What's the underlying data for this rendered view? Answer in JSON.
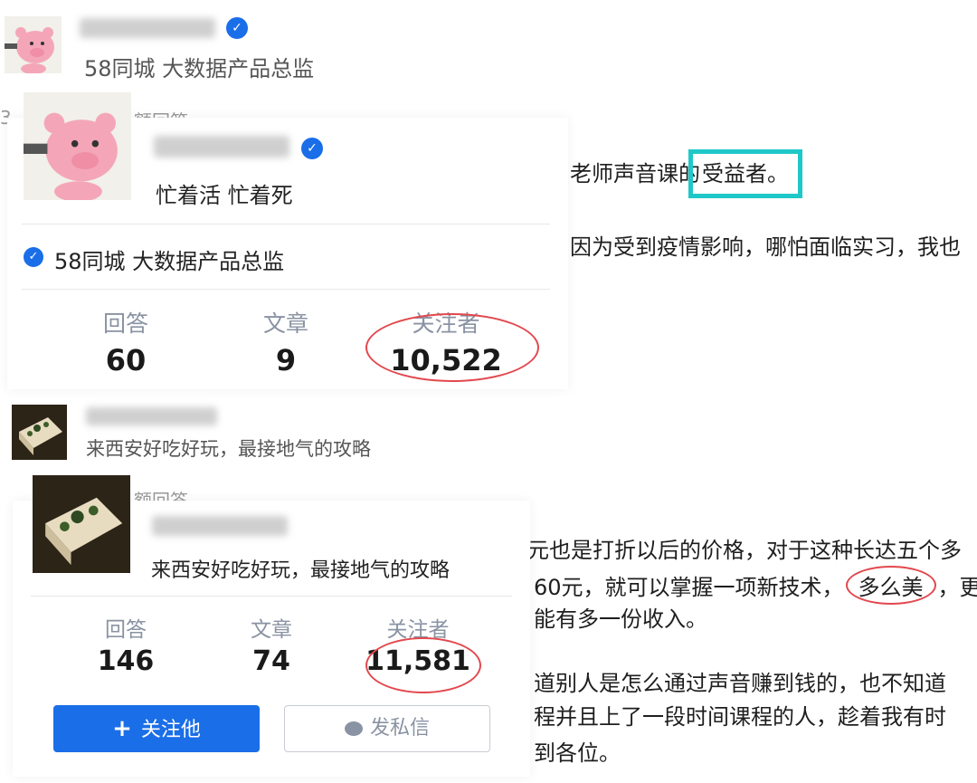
{
  "profile1": {
    "header_subtitle": "58同城 大数据产品总监",
    "partial_text_under": "3",
    "partial_text_tag": "额回答",
    "card": {
      "bio": "忙着活 忙着死",
      "company": "58同城 大数据产品总监",
      "stats": [
        {
          "label": "回答",
          "value": "60"
        },
        {
          "label": "文章",
          "value": "9"
        },
        {
          "label": "关注者",
          "value": "10,522"
        }
      ]
    }
  },
  "article1": {
    "line1_prefix": "老师声音课的",
    "line1_highlight": "受益者。",
    "line2": "因为受到疫情影响，哪怕面临实习，我也"
  },
  "profile2": {
    "header_subtitle": "来西安好吃好玩，最接地气的攻略",
    "partial_text_tag": "额回答",
    "card": {
      "bio": "来西安好吃好玩，最接地气的攻略",
      "stats": [
        {
          "label": "回答",
          "value": "146"
        },
        {
          "label": "文章",
          "value": "74"
        },
        {
          "label": "关注者",
          "value": "11,581"
        }
      ],
      "follow_button": "关注他",
      "message_button": "发私信"
    }
  },
  "article2": {
    "line1": "元也是打折以后的价格，对于这种长达五个多",
    "line2_prefix": "60元，就可以掌握一项新技术，",
    "line2_circled": "多么美",
    "line2_suffix": "，更",
    "line3": "能有多一份收入。",
    "line4": "道别人是怎么通过声音赚到钱的，也不知道",
    "line5": "程并且上了一段时间课程的人，趁着我有时",
    "line6": "到各位。"
  },
  "colors": {
    "accent": "#1a6ee8",
    "highlight_box": "#1fc8c8",
    "annotation_ring": "#e2484e"
  },
  "icons": {
    "verified": "verified-check-icon",
    "plus": "plus-icon",
    "chat": "chat-bubble-icon"
  }
}
